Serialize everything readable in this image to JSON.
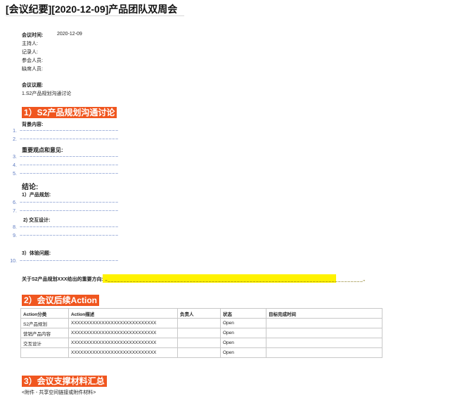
{
  "title": "[会议纪要][2020-12-09]产品团队双周会",
  "meta": {
    "time_label": "会议时间:",
    "time_value": "2020-12-09",
    "host_label": "主持人:",
    "recorder_label": "记录人:",
    "attendees_label": "参会人员:",
    "absent_label": "缺席人员:"
  },
  "agenda": {
    "label": "会议议题:",
    "item": "1.S2产品规划沟通讨论"
  },
  "section1": {
    "heading": "1）S2产品规划沟通讨论",
    "background_label": "背景内容:",
    "opinions_label": "重要观点和意见:",
    "conclusion_label": "结论:",
    "planning_label": "1）产品规划:",
    "design_label": "2) 交互设计:",
    "experience_label": "3）体验问题:",
    "list": [
      {
        "num": "1.",
        "text": "~~~~~~~~~~~~~~~~~~~~~~~~~~~~~~"
      },
      {
        "num": "2.",
        "text": "~~~~~~~~~~~~~~~~~~~~~~~~~~~~~~"
      },
      {
        "num": "3.",
        "text": "~~~~~~~~~~~~~~~~~~~~~~~~~~~~~~"
      },
      {
        "num": "4.",
        "text": "~~~~~~~~~~~~~~~~~~~~~~~~~~~~~~"
      },
      {
        "num": "5.",
        "text": "~~~~~~~~~~~~~~~~~~~~~~~~~~~~~~"
      },
      {
        "num": "6.",
        "text": "~~~~~~~~~~~~~~~~~~~~~~~~~~~~~~"
      },
      {
        "num": "7.",
        "text": "~~~~~~~~~~~~~~~~~~~~~~~~~~~~~~"
      },
      {
        "num": "8.",
        "text": "~~~~~~~~~~~~~~~~~~~~~~~~~~~~~~"
      },
      {
        "num": "9.",
        "text": "~~~~~~~~~~~~~~~~~~~~~~~~~~~~~~"
      },
      {
        "num": "10.",
        "text": "~~~~~~~~~~~~~~~~~~~~~~~~~~~~~~"
      }
    ],
    "direction_label": "关于S2产品规划XXX给出的重要方向:",
    "direction_value": "\"~~~~~~~~~~~~~~~~~~~~~~~~~~~~~~~~~~~~~~~~~~~~~~~~~~~~~~~~~~~~~~~~~~~~~~~~~~~~~~~~~\""
  },
  "section2": {
    "heading": "2）会议后续Action",
    "columns": [
      "Action分类",
      "Action描述",
      "负责人",
      "状态",
      "目标完成时间"
    ],
    "rows": [
      [
        "S2产品规划",
        "XXXXXXXXXXXXXXXXXXXXXXXXXXXX",
        "",
        "Open",
        ""
      ],
      [
        "营销产品内容",
        "XXXXXXXXXXXXXXXXXXXXXXXXXXXX",
        "",
        "Open",
        ""
      ],
      [
        "交互设计",
        "XXXXXXXXXXXXXXXXXXXXXXXXXXXX",
        "",
        "Open",
        ""
      ],
      [
        "",
        "XXXXXXXXXXXXXXXXXXXXXXXXXXXX",
        "",
        "Open",
        ""
      ]
    ]
  },
  "section3": {
    "heading": "3）会议支撑材料汇总",
    "note": "<附件 - 共享空间链接或附件材料>"
  }
}
